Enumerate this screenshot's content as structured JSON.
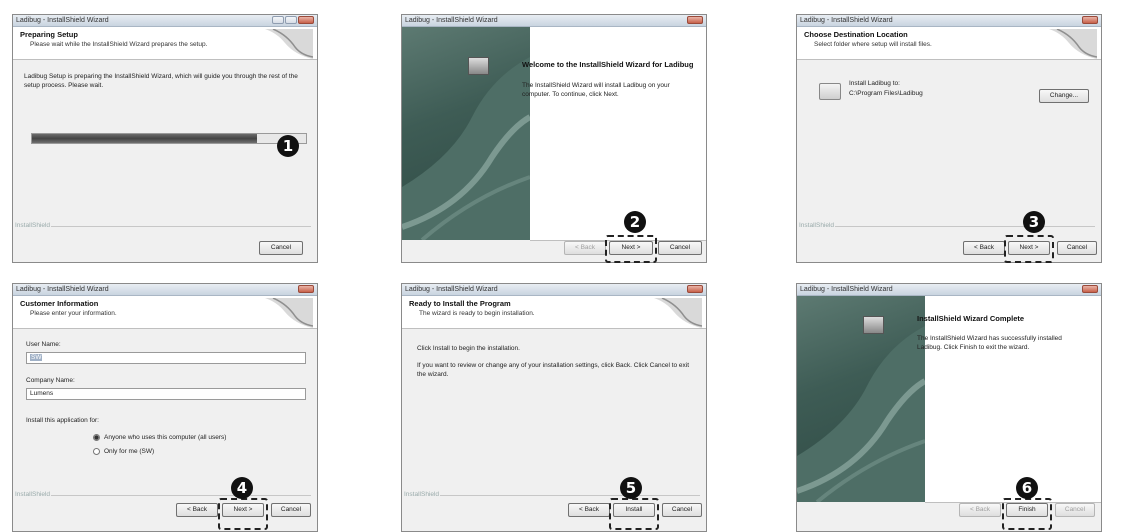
{
  "win_title": "Ladibug - InstallShield Wizard",
  "installshield_brand": "InstallShield",
  "badge_color": "#111111",
  "panels": {
    "p1": {
      "header_title": "Preparing Setup",
      "header_sub": "Please wait while the InstallShield Wizard prepares the setup.",
      "body": "Ladibug Setup is preparing the InstallShield Wizard, which will guide you through the rest of the setup process. Please wait.",
      "progress": 0.82,
      "cancel": "Cancel",
      "badge": "1"
    },
    "p2": {
      "welcome_title": "Welcome to the InstallShield Wizard for Ladibug",
      "welcome_text": "The InstallShield Wizard will install Ladibug on your computer.  To continue, click Next.",
      "back": "< Back",
      "next": "Next >",
      "cancel": "Cancel",
      "badge": "2"
    },
    "p3": {
      "header_title": "Choose Destination Location",
      "header_sub": "Select folder where setup will install files.",
      "install_to": "Install Ladibug to:",
      "path": "C:\\Program Files\\Ladibug",
      "change": "Change...",
      "back": "< Back",
      "next": "Next >",
      "cancel": "Cancel",
      "badge": "3"
    },
    "p4": {
      "header_title": "Customer Information",
      "header_sub": "Please enter your information.",
      "user_label": "User Name:",
      "user_value": "SW",
      "company_label": "Company Name:",
      "company_value": "Lumens",
      "install_for": "Install this application for:",
      "opt_all": "Anyone who uses this computer (all users)",
      "opt_me": "Only for me (SW)",
      "back": "< Back",
      "next": "Next >",
      "cancel": "Cancel",
      "badge": "4"
    },
    "p5": {
      "header_title": "Ready to Install the Program",
      "header_sub": "The wizard is ready to begin installation.",
      "line1": "Click Install to begin the installation.",
      "line2": "If you want to review or change any of your installation settings, click Back. Click Cancel to exit the wizard.",
      "back": "< Back",
      "install": "Install",
      "cancel": "Cancel",
      "badge": "5"
    },
    "p6": {
      "complete_title": "InstallShield Wizard Complete",
      "complete_text": "The InstallShield Wizard has successfully installed Ladibug. Click Finish to exit the wizard.",
      "back": "< Back",
      "finish": "Finish",
      "cancel": "Cancel",
      "badge": "6"
    }
  }
}
